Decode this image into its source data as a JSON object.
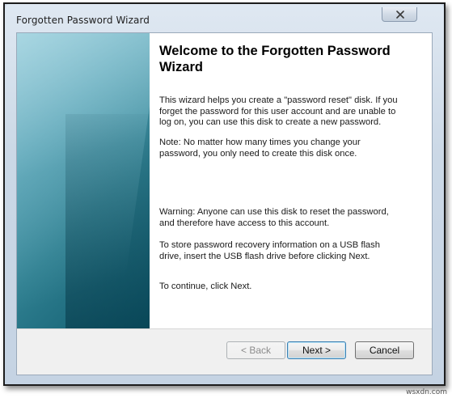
{
  "window": {
    "title": "Forgotten Password Wizard"
  },
  "main": {
    "heading": "Welcome to the Forgotten Password Wizard",
    "paragraphs": [
      "This wizard helps you create a \"password reset\" disk. If you forget the password for this user account and are unable to log on, you can use this disk to create a new password.",
      "Note: No matter how many times you change your password, you only need to create this disk once.",
      "Warning: Anyone can use this disk to reset the password, and therefore have access to this account.",
      "To store password recovery information on a USB flash drive, insert the USB flash drive before clicking Next.",
      "To continue, click Next."
    ]
  },
  "buttons": {
    "back_label": "< Back",
    "next_label": "Next >",
    "cancel_label": "Cancel",
    "back_enabled": false
  },
  "icons": {
    "close": "close-icon"
  },
  "watermark": "wsxdn.com"
}
